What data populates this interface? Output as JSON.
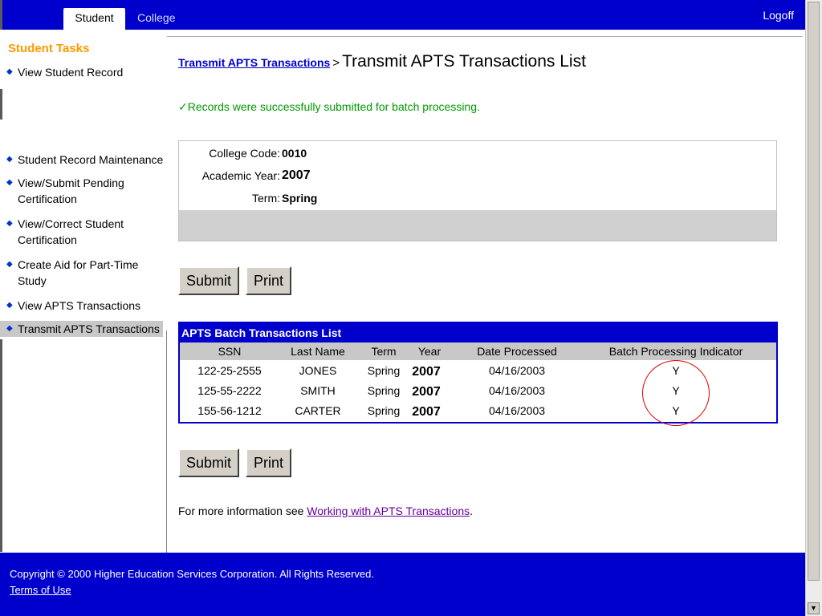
{
  "topbar": {
    "tabs": [
      {
        "label": "Student",
        "active": true
      },
      {
        "label": "College",
        "active": false
      }
    ],
    "logoff": "Logoff"
  },
  "sidebar": {
    "title": "Student Tasks",
    "items": [
      {
        "label": "View Student Record"
      },
      {
        "label": "Student Record Maintenance"
      },
      {
        "label": "View/Submit Pending Certification"
      },
      {
        "label": "View/Correct Student Certification"
      },
      {
        "label": "Create Aid for Part-Time Study"
      },
      {
        "label": "View APTS Transactions"
      },
      {
        "label": "Transmit APTS Transactions",
        "active": true
      }
    ]
  },
  "main": {
    "breadcrumb_link": "Transmit APTS Transactions",
    "breadcrumb_sep": ">",
    "title": "Transmit APTS Transactions List",
    "success_msg": "✓Records were successfully submitted for batch processing.",
    "info": {
      "college_code_label": "College Code:",
      "college_code": "0010",
      "academic_year_label": "Academic Year:",
      "academic_year": "2007",
      "term_label": "Term:",
      "term": "Spring"
    },
    "buttons": {
      "submit": "Submit",
      "print": "Print"
    },
    "batch": {
      "title": "APTS Batch Transactions List",
      "columns": [
        "SSN",
        "Last Name",
        "Term",
        "Year",
        "Date Processed",
        "Batch Processing Indicator"
      ],
      "rows": [
        [
          "122-25-2555",
          "JONES",
          "Spring",
          "2007",
          "04/16/2003",
          "Y"
        ],
        [
          "125-55-2222",
          "SMITH",
          "Spring",
          "2007",
          "04/16/2003",
          "Y"
        ],
        [
          "155-56-1212",
          "CARTER",
          "Spring",
          "2007",
          "04/16/2003",
          "Y"
        ]
      ]
    },
    "more_info_text": "For more information see ",
    "more_info_link": "Working with APTS Transactions",
    "more_info_end": "."
  },
  "footer": {
    "copyright": "Copyright © 2000 Higher Education Services Corporation. All Rights Reserved.",
    "terms": "Terms of Use"
  },
  "colors": {
    "brand_blue": "#0000cc",
    "task_orange": "#ff9900",
    "success_green": "#009900",
    "highlight_red": "#dd0000"
  }
}
